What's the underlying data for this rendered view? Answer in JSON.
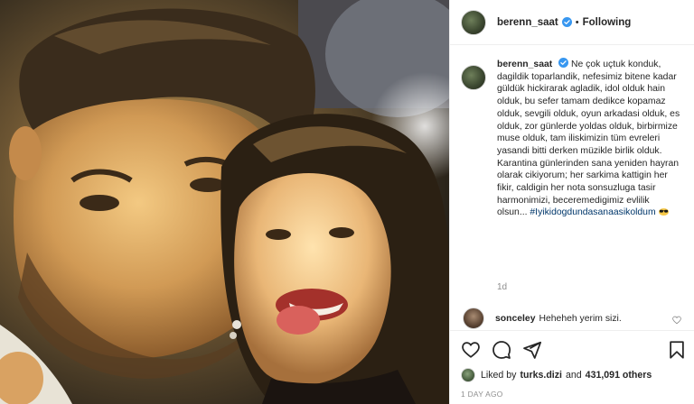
{
  "header": {
    "username": "berenn_saat",
    "separator": "•",
    "follow_status": "Following"
  },
  "caption": {
    "username": "berenn_saat",
    "text": "Ne çok uçtuk konduk, dagildik toparlandik, nefesimiz bitene kadar güldük hickirarak agladik, idol olduk hain olduk, bu sefer tamam dedikce kopamaz olduk, sevgili olduk, oyun arkadasi olduk, es olduk, zor günlerde yoldas olduk, birbirmize muse olduk, tam iliskimizin tüm evreleri yasandi bitti derken müzikle birlik olduk. Karantina günlerinden sana yeniden hayran olarak cikiyorum; her sarkima kattigin her fikir, caldigin her nota sonsuzluga tasir harmonimizi, beceremedigimiz evlilik olsun...",
    "hashtag": "#Iyikidogdundasanaasikoldum",
    "emoji": "sunglasses-emoji",
    "age": "1d"
  },
  "comment": {
    "username": "sonceley",
    "text": "Heheheh yerim sizi."
  },
  "actions": {
    "like_icon": "heart-outline-icon",
    "comment_icon": "speech-bubble-icon",
    "share_icon": "paper-plane-icon",
    "save_icon": "bookmark-icon"
  },
  "likes": {
    "prefix": "Liked by",
    "user": "turks.dizi",
    "conjunction": "and",
    "count": "431,091 others"
  },
  "timestamp": "1 DAY AGO",
  "colors": {
    "verified": "#3897f0",
    "hashtag": "#00376b",
    "muted": "#8e8e8e",
    "border": "#efefef"
  }
}
